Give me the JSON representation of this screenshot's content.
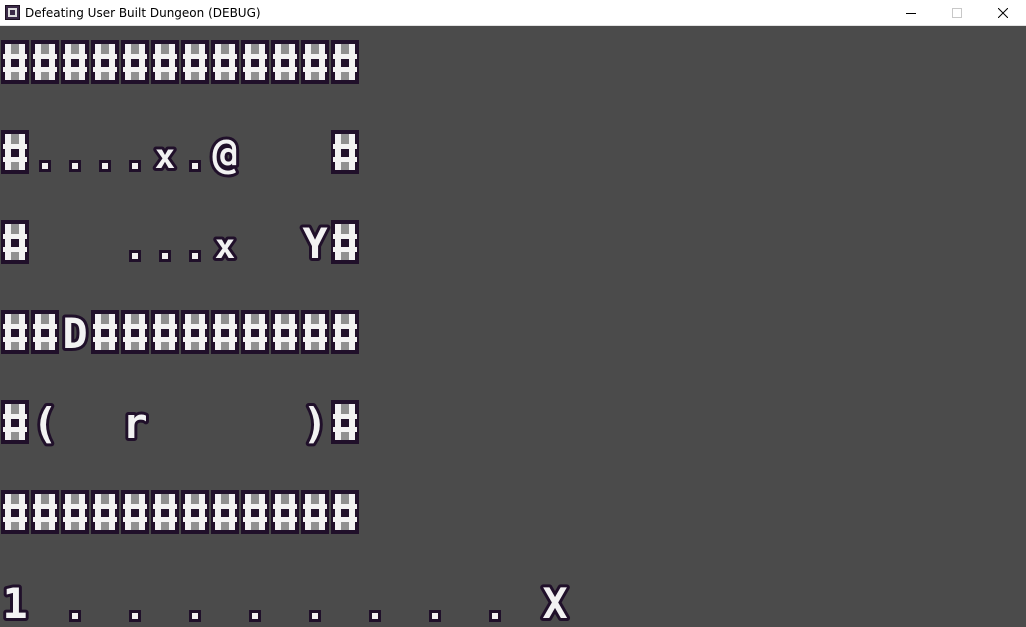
{
  "window": {
    "title": "Defeating User Built Dungeon (DEBUG)",
    "app_icon": "game-app-icon",
    "controls": {
      "minimize_icon": "minimize-icon",
      "maximize_icon": "maximize-icon",
      "close_icon": "close-icon"
    }
  },
  "colors": {
    "background": "#4b4b4b",
    "glyph_fill": "#f2f2f2",
    "glyph_shade": "#8f8f8f",
    "glyph_outline": "#20102a"
  },
  "map": {
    "rows": [
      "############",
      "#....x.@   #",
      "#   ...x  Y#",
      "##D#########",
      "#(  r     )#",
      "############",
      "1 . . . . . . . . X"
    ]
  }
}
